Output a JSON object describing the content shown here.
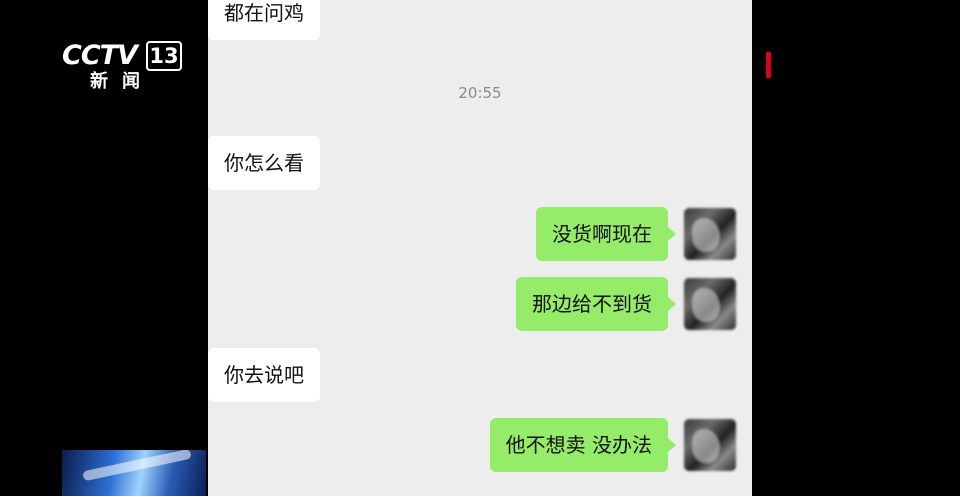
{
  "logo": {
    "wordmark": "CCTV",
    "channel": "13",
    "subtitle": "新闻"
  },
  "chat": {
    "timestamp": "20:55",
    "messages": [
      {
        "side": "left",
        "text": "都在问鸡"
      },
      {
        "side": "left",
        "text": "你怎么看"
      },
      {
        "side": "right",
        "text": "没货啊现在"
      },
      {
        "side": "right",
        "text": "那边给不到货"
      },
      {
        "side": "left",
        "text": "你去说吧"
      },
      {
        "side": "right",
        "text": "他不想卖 没办法"
      }
    ]
  },
  "colors": {
    "chat_background": "#ededed",
    "incoming_bubble": "#ffffff",
    "outgoing_bubble": "#95ec69",
    "marker": "#d9001b"
  }
}
